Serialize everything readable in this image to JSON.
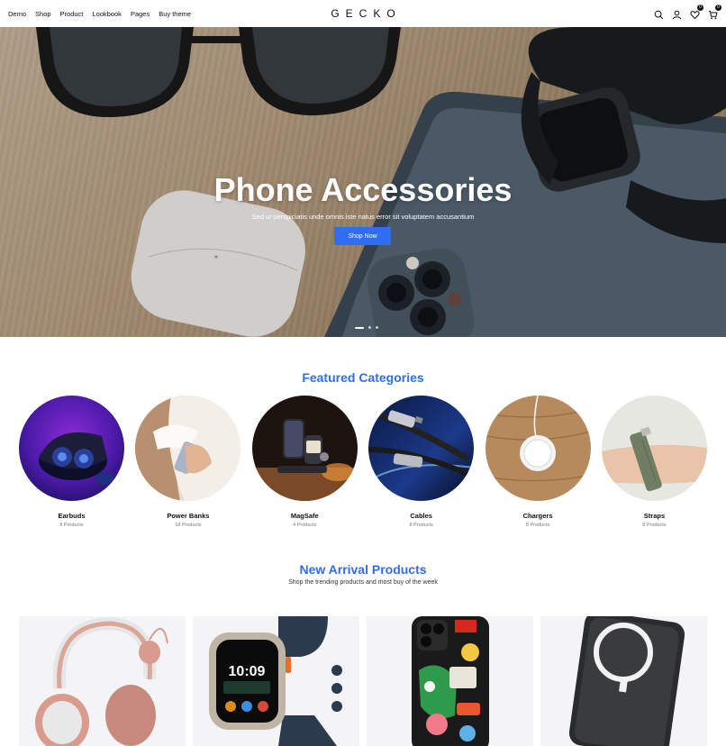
{
  "header": {
    "nav": [
      "Demo",
      "Shop",
      "Product",
      "Lookbook",
      "Pages",
      "Buy theme"
    ],
    "logo": "GECKO",
    "wishlist_count": "0",
    "cart_count": "0",
    "icons": [
      "search-icon",
      "user-icon",
      "heart-icon",
      "cart-icon"
    ]
  },
  "hero": {
    "title": "Phone Accessories",
    "subtitle": "Sed ut perspiciatis unde omnis iste natus error sit voluptatem accusantium",
    "button": "Shop Now",
    "slides": 3,
    "active_slide": 1
  },
  "featured": {
    "title": "Featured Categories",
    "categories": [
      {
        "name": "Earbuds",
        "count": "8 Products"
      },
      {
        "name": "Power Banks",
        "count": "18 Products"
      },
      {
        "name": "MagSafe",
        "count": "4 Products"
      },
      {
        "name": "Cables",
        "count": "8 Products"
      },
      {
        "name": "Chargers",
        "count": "8 Products"
      },
      {
        "name": "Straps",
        "count": "8 Products"
      }
    ]
  },
  "arrivals": {
    "title": "New Arrival Products",
    "subtitle": "Shop the trending products and most buy of the week",
    "products": [
      "headphones",
      "smart-watch",
      "phone-case",
      "power-bank"
    ]
  },
  "colors": {
    "accent": "#2f6ef1",
    "text": "#111111",
    "muted": "#777777"
  }
}
